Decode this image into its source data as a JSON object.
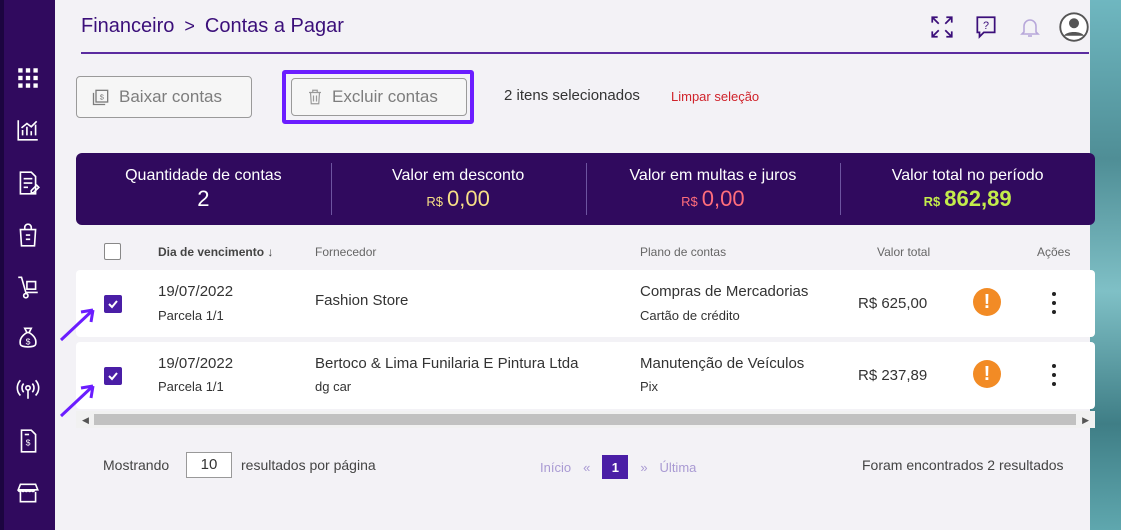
{
  "breadcrumb": {
    "parent": "Financeiro",
    "separator": ">",
    "current": "Contas a Pagar"
  },
  "toolbar": {
    "baixar_label": "Baixar contas",
    "excluir_label": "Excluir contas",
    "selected_text": "2 itens selecionados",
    "clear_label": "Limpar seleção"
  },
  "summary": {
    "quantidade_label": "Quantidade de contas",
    "quantidade_value": "2",
    "desconto_label": "Valor em desconto",
    "desconto_currency": "R$",
    "desconto_value": "0,00",
    "multas_label": "Valor em multas e juros",
    "multas_currency": "R$",
    "multas_value": "0,00",
    "total_label": "Valor total no período",
    "total_currency": "R$",
    "total_value": "862,89"
  },
  "table": {
    "headers": {
      "vencimento": "Dia de vencimento",
      "sort_arrow": "↓",
      "fornecedor": "Fornecedor",
      "plano": "Plano de contas",
      "valor": "Valor total",
      "acoes": "Ações"
    },
    "rows": [
      {
        "date": "19/07/2022",
        "parcela": "Parcela 1/1",
        "fornecedor": "Fashion Store",
        "fornecedor_sub": "",
        "plano": "Compras de Mercadorias",
        "plano_sub": "Cartão de crédito",
        "valor": "R$ 625,00",
        "checked": true
      },
      {
        "date": "19/07/2022",
        "parcela": "Parcela 1/1",
        "fornecedor": "Bertoco & Lima Funilaria E Pintura Ltda",
        "fornecedor_sub": "dg car",
        "plano": "Manutenção de Veículos",
        "plano_sub": "Pix",
        "valor": "R$ 237,89",
        "checked": true
      }
    ]
  },
  "footer": {
    "showing": "Mostrando",
    "page_size": "10",
    "per_page": "resultados por página",
    "first": "Início",
    "prev": "«",
    "current_page": "1",
    "next": "»",
    "last": "Última",
    "found": "Foram encontrados 2 resultados"
  },
  "colors": {
    "sidebar": "#300a5e",
    "accent": "#4a1ea6",
    "highlight_border": "#6b1dff",
    "alert": "#f28b25",
    "total_green": "#c3ec4b"
  },
  "icons": {
    "sidebar": [
      "apps-grid-icon",
      "chart-icon",
      "document-edit-icon",
      "shopping-bag-icon",
      "hand-truck-icon",
      "money-bag-icon",
      "broadcast-icon",
      "receipt-icon",
      "storefront-icon"
    ],
    "header": [
      "expand-icon",
      "help-chat-icon",
      "bell-icon",
      "user-avatar-icon"
    ]
  }
}
